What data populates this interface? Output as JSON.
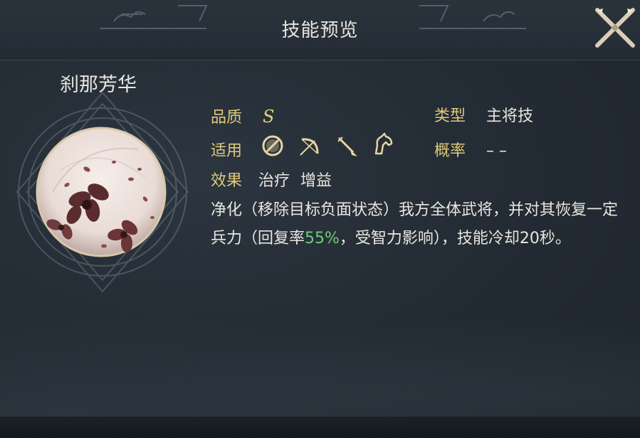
{
  "header": {
    "title": "技能预览"
  },
  "skill": {
    "name": "刹那芳华",
    "icon": "plum-blossom-orb-icon",
    "quality_label": "品质",
    "quality_value": "S",
    "type_label": "类型",
    "type_value": "主将技",
    "applicable_label": "适用",
    "applicable_units": [
      "shield-unit-icon",
      "bow-unit-icon",
      "spear-unit-icon",
      "cavalry-unit-icon"
    ],
    "probability_label": "概率",
    "probability_value": "– –",
    "effect_label": "效果",
    "effect_tags": [
      "治疗",
      "增益"
    ],
    "description_part1": "净化（移除目标负面状态）我方全体武将，并对其恢复一定兵力（回复率",
    "description_rate": "55%",
    "description_part2": "，受智力影响），技能冷却20秒。"
  },
  "colors": {
    "label_gold": "#e0c97a",
    "text_light": "#e8e6df",
    "highlight_green": "#6fcc78",
    "background": "#242c35"
  },
  "controls": {
    "close_icon": "crossed-swords-close-icon"
  }
}
